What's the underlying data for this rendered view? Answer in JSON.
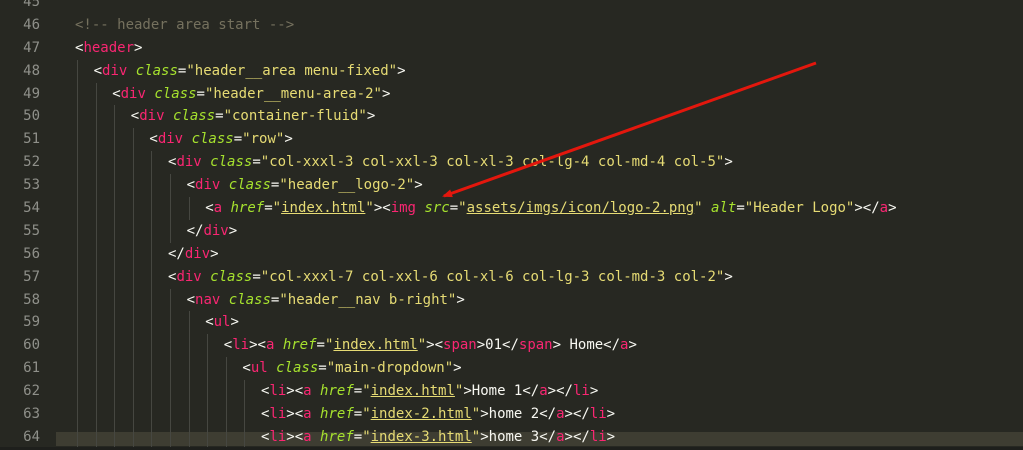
{
  "editor": {
    "colors": {
      "background": "#272822",
      "gutter_text": "#8f908a",
      "comment": "#75715e",
      "tag": "#f92672",
      "attribute": "#a6e22e",
      "string": "#e6db74",
      "text": "#f8f8f2",
      "annotation_arrow": "#e3170d"
    },
    "lines": [
      {
        "number": "45",
        "indent": 0,
        "tokens": []
      },
      {
        "number": "46",
        "indent": 0,
        "tokens": [
          {
            "t": "comment",
            "v": "<!-- header area start -->"
          }
        ]
      },
      {
        "number": "47",
        "indent": 0,
        "tokens": [
          {
            "t": "text",
            "v": "<"
          },
          {
            "t": "tag",
            "v": "header"
          },
          {
            "t": "text",
            "v": ">"
          }
        ]
      },
      {
        "number": "48",
        "indent": 1,
        "tokens": [
          {
            "t": "text",
            "v": "<"
          },
          {
            "t": "tag",
            "v": "div"
          },
          {
            "t": "text",
            "v": " "
          },
          {
            "t": "attr",
            "v": "class"
          },
          {
            "t": "text",
            "v": "="
          },
          {
            "t": "str",
            "v": "\"header__area menu-fixed\""
          },
          {
            "t": "text",
            "v": ">"
          }
        ]
      },
      {
        "number": "49",
        "indent": 2,
        "tokens": [
          {
            "t": "text",
            "v": "<"
          },
          {
            "t": "tag",
            "v": "div"
          },
          {
            "t": "text",
            "v": " "
          },
          {
            "t": "attr",
            "v": "class"
          },
          {
            "t": "text",
            "v": "="
          },
          {
            "t": "str",
            "v": "\"header__menu-area-2\""
          },
          {
            "t": "text",
            "v": ">"
          }
        ]
      },
      {
        "number": "50",
        "indent": 3,
        "tokens": [
          {
            "t": "text",
            "v": "<"
          },
          {
            "t": "tag",
            "v": "div"
          },
          {
            "t": "text",
            "v": " "
          },
          {
            "t": "attr",
            "v": "class"
          },
          {
            "t": "text",
            "v": "="
          },
          {
            "t": "str",
            "v": "\"container-fluid\""
          },
          {
            "t": "text",
            "v": ">"
          }
        ]
      },
      {
        "number": "51",
        "indent": 4,
        "tokens": [
          {
            "t": "text",
            "v": "<"
          },
          {
            "t": "tag",
            "v": "div"
          },
          {
            "t": "text",
            "v": " "
          },
          {
            "t": "attr",
            "v": "class"
          },
          {
            "t": "text",
            "v": "="
          },
          {
            "t": "str",
            "v": "\"row\""
          },
          {
            "t": "text",
            "v": ">"
          }
        ]
      },
      {
        "number": "52",
        "indent": 5,
        "tokens": [
          {
            "t": "text",
            "v": "<"
          },
          {
            "t": "tag",
            "v": "div"
          },
          {
            "t": "text",
            "v": " "
          },
          {
            "t": "attr",
            "v": "class"
          },
          {
            "t": "text",
            "v": "="
          },
          {
            "t": "str",
            "v": "\"col-xxxl-3 col-xxl-3 col-xl-3 col-lg-4 col-md-4 col-5\""
          },
          {
            "t": "text",
            "v": ">"
          }
        ]
      },
      {
        "number": "53",
        "indent": 6,
        "tokens": [
          {
            "t": "text",
            "v": "<"
          },
          {
            "t": "tag",
            "v": "div"
          },
          {
            "t": "text",
            "v": " "
          },
          {
            "t": "attr",
            "v": "class"
          },
          {
            "t": "text",
            "v": "="
          },
          {
            "t": "str",
            "v": "\"header__logo-2\""
          },
          {
            "t": "text",
            "v": ">"
          }
        ]
      },
      {
        "number": "54",
        "indent": 7,
        "tokens": [
          {
            "t": "text",
            "v": "<"
          },
          {
            "t": "tag",
            "v": "a"
          },
          {
            "t": "text",
            "v": " "
          },
          {
            "t": "attr",
            "v": "href"
          },
          {
            "t": "text",
            "v": "="
          },
          {
            "t": "str",
            "v": "\""
          },
          {
            "t": "link",
            "v": "index.html"
          },
          {
            "t": "str",
            "v": "\""
          },
          {
            "t": "text",
            "v": "><"
          },
          {
            "t": "tag",
            "v": "img"
          },
          {
            "t": "text",
            "v": " "
          },
          {
            "t": "attr",
            "v": "src"
          },
          {
            "t": "text",
            "v": "="
          },
          {
            "t": "str",
            "v": "\""
          },
          {
            "t": "link",
            "v": "assets/imgs/icon/logo-2.png"
          },
          {
            "t": "str",
            "v": "\""
          },
          {
            "t": "text",
            "v": " "
          },
          {
            "t": "attr",
            "v": "alt"
          },
          {
            "t": "text",
            "v": "="
          },
          {
            "t": "str",
            "v": "\"Header Logo\""
          },
          {
            "t": "text",
            "v": "></"
          },
          {
            "t": "tag",
            "v": "a"
          },
          {
            "t": "text",
            "v": ">"
          }
        ]
      },
      {
        "number": "55",
        "indent": 6,
        "tokens": [
          {
            "t": "text",
            "v": "</"
          },
          {
            "t": "tag",
            "v": "div"
          },
          {
            "t": "text",
            "v": ">"
          }
        ]
      },
      {
        "number": "56",
        "indent": 5,
        "tokens": [
          {
            "t": "text",
            "v": "</"
          },
          {
            "t": "tag",
            "v": "div"
          },
          {
            "t": "text",
            "v": ">"
          }
        ]
      },
      {
        "number": "57",
        "indent": 5,
        "tokens": [
          {
            "t": "text",
            "v": "<"
          },
          {
            "t": "tag",
            "v": "div"
          },
          {
            "t": "text",
            "v": " "
          },
          {
            "t": "attr",
            "v": "class"
          },
          {
            "t": "text",
            "v": "="
          },
          {
            "t": "str",
            "v": "\"col-xxxl-7 col-xxl-6 col-xl-6 col-lg-3 col-md-3 col-2\""
          },
          {
            "t": "text",
            "v": ">"
          }
        ]
      },
      {
        "number": "58",
        "indent": 6,
        "tokens": [
          {
            "t": "text",
            "v": "<"
          },
          {
            "t": "tag",
            "v": "nav"
          },
          {
            "t": "text",
            "v": " "
          },
          {
            "t": "attr",
            "v": "class"
          },
          {
            "t": "text",
            "v": "="
          },
          {
            "t": "str",
            "v": "\"header__nav b-right\""
          },
          {
            "t": "text",
            "v": ">"
          }
        ]
      },
      {
        "number": "59",
        "indent": 7,
        "tokens": [
          {
            "t": "text",
            "v": "<"
          },
          {
            "t": "tag",
            "v": "ul"
          },
          {
            "t": "text",
            "v": ">"
          }
        ]
      },
      {
        "number": "60",
        "indent": 8,
        "tokens": [
          {
            "t": "text",
            "v": "<"
          },
          {
            "t": "tag",
            "v": "li"
          },
          {
            "t": "text",
            "v": "><"
          },
          {
            "t": "tag",
            "v": "a"
          },
          {
            "t": "text",
            "v": " "
          },
          {
            "t": "attr",
            "v": "href"
          },
          {
            "t": "text",
            "v": "="
          },
          {
            "t": "str",
            "v": "\""
          },
          {
            "t": "link",
            "v": "index.html"
          },
          {
            "t": "str",
            "v": "\""
          },
          {
            "t": "text",
            "v": "><"
          },
          {
            "t": "tag",
            "v": "span"
          },
          {
            "t": "text",
            "v": ">01</"
          },
          {
            "t": "tag",
            "v": "span"
          },
          {
            "t": "text",
            "v": "> Home</"
          },
          {
            "t": "tag",
            "v": "a"
          },
          {
            "t": "text",
            "v": ">"
          }
        ]
      },
      {
        "number": "61",
        "indent": 9,
        "tokens": [
          {
            "t": "text",
            "v": "<"
          },
          {
            "t": "tag",
            "v": "ul"
          },
          {
            "t": "text",
            "v": " "
          },
          {
            "t": "attr",
            "v": "class"
          },
          {
            "t": "text",
            "v": "="
          },
          {
            "t": "str",
            "v": "\"main-dropdown\""
          },
          {
            "t": "text",
            "v": ">"
          }
        ]
      },
      {
        "number": "62",
        "indent": 10,
        "tokens": [
          {
            "t": "text",
            "v": "<"
          },
          {
            "t": "tag",
            "v": "li"
          },
          {
            "t": "text",
            "v": "><"
          },
          {
            "t": "tag",
            "v": "a"
          },
          {
            "t": "text",
            "v": " "
          },
          {
            "t": "attr",
            "v": "href"
          },
          {
            "t": "text",
            "v": "="
          },
          {
            "t": "str",
            "v": "\""
          },
          {
            "t": "link",
            "v": "index.html"
          },
          {
            "t": "str",
            "v": "\""
          },
          {
            "t": "text",
            "v": ">Home 1</"
          },
          {
            "t": "tag",
            "v": "a"
          },
          {
            "t": "text",
            "v": "></"
          },
          {
            "t": "tag",
            "v": "li"
          },
          {
            "t": "text",
            "v": ">"
          }
        ]
      },
      {
        "number": "63",
        "indent": 10,
        "tokens": [
          {
            "t": "text",
            "v": "<"
          },
          {
            "t": "tag",
            "v": "li"
          },
          {
            "t": "text",
            "v": "><"
          },
          {
            "t": "tag",
            "v": "a"
          },
          {
            "t": "text",
            "v": " "
          },
          {
            "t": "attr",
            "v": "href"
          },
          {
            "t": "text",
            "v": "="
          },
          {
            "t": "str",
            "v": "\""
          },
          {
            "t": "link",
            "v": "index-2.html"
          },
          {
            "t": "str",
            "v": "\""
          },
          {
            "t": "text",
            "v": ">home 2</"
          },
          {
            "t": "tag",
            "v": "a"
          },
          {
            "t": "text",
            "v": "></"
          },
          {
            "t": "tag",
            "v": "li"
          },
          {
            "t": "text",
            "v": ">"
          }
        ]
      },
      {
        "number": "64",
        "indent": 10,
        "tokens": [
          {
            "t": "text",
            "v": "<"
          },
          {
            "t": "tag",
            "v": "li"
          },
          {
            "t": "text",
            "v": "><"
          },
          {
            "t": "tag",
            "v": "a"
          },
          {
            "t": "text",
            "v": " "
          },
          {
            "t": "attr",
            "v": "href"
          },
          {
            "t": "text",
            "v": "="
          },
          {
            "t": "str",
            "v": "\""
          },
          {
            "t": "link",
            "v": "index-3.html"
          },
          {
            "t": "str",
            "v": "\""
          },
          {
            "t": "text",
            "v": ">home 3</"
          },
          {
            "t": "tag",
            "v": "a"
          },
          {
            "t": "text",
            "v": "></"
          },
          {
            "t": "tag",
            "v": "li"
          },
          {
            "t": "text",
            "v": ">"
          }
        ]
      }
    ]
  }
}
